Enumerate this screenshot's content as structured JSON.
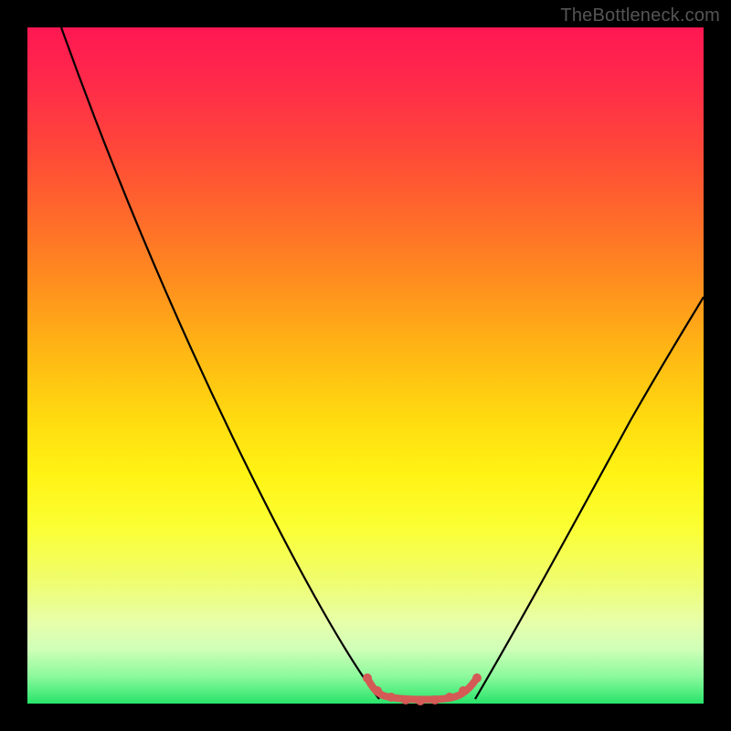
{
  "watermark": "TheBottleneck.com",
  "colors": {
    "curve_stroke": "#000000",
    "valley_stroke": "#d45a56",
    "frame_bg": "#000000"
  },
  "chart_data": {
    "type": "line",
    "title": "",
    "xlabel": "",
    "ylabel": "",
    "xlim": [
      0,
      100
    ],
    "ylim": [
      0,
      100
    ],
    "grid": false,
    "series": [
      {
        "name": "left-branch",
        "x": [
          5,
          10,
          15,
          20,
          25,
          30,
          35,
          40,
          45,
          50,
          52
        ],
        "y": [
          100,
          88,
          77,
          66,
          55,
          44,
          33,
          22,
          13,
          4,
          0
        ]
      },
      {
        "name": "right-branch",
        "x": [
          66,
          70,
          75,
          80,
          85,
          90,
          95,
          100
        ],
        "y": [
          0,
          8,
          18,
          28,
          38,
          47,
          55,
          62
        ]
      },
      {
        "name": "valley-floor",
        "x": [
          50,
          52,
          54,
          56,
          58,
          60,
          62,
          64,
          66,
          67
        ],
        "y": [
          3.5,
          1.2,
          0.6,
          0.3,
          0.3,
          0.3,
          0.5,
          0.9,
          1.6,
          3.0
        ]
      }
    ],
    "annotations": [
      {
        "text": "TheBottleneck.com",
        "position": "top-right"
      }
    ]
  }
}
